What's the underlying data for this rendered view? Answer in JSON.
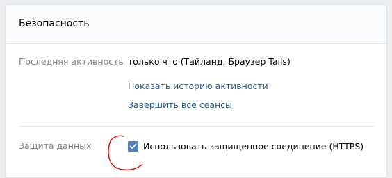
{
  "section": {
    "title": "Безопасность"
  },
  "activity": {
    "label": "Последняя активность",
    "value": "только что (Тайланд, Браузер Tails)",
    "show_history_link": "Показать историю активности",
    "end_sessions_link": "Завершить все сеансы"
  },
  "protection": {
    "label": "Защита данных",
    "https_checkbox_label": "Использовать защищенное соединение (HTTPS)",
    "https_checked": true
  },
  "colors": {
    "accent": "#5181b8",
    "link": "#2a5885",
    "annotation": "#e00000"
  }
}
